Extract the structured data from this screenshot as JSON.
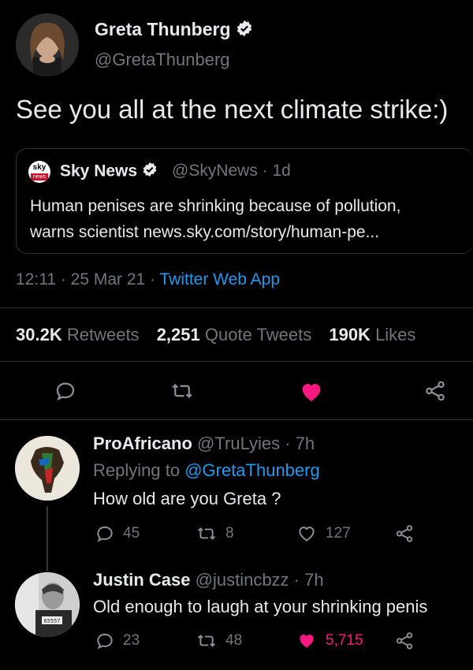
{
  "main_tweet": {
    "author_name": "Greta Thunberg",
    "author_handle": "@GretaThunberg",
    "text": "See you all at the next climate strike:)",
    "quoted": {
      "logo_text_top": "sky",
      "logo_text_bottom": "news",
      "name": "Sky News",
      "handle_time": "@SkyNews · 1d",
      "text_line1": "Human penises are shrinking because of pollution,",
      "text_line2": "warns scientist news.sky.com/story/human-pe..."
    },
    "time_date": "12:11 · 25 Mar 21 · ",
    "source": "Twitter Web App",
    "stats": {
      "retweets_count": "30.2K",
      "retweets_label": "Retweets",
      "quotes_count": "2,251",
      "quotes_label": "Quote Tweets",
      "likes_count": "190K",
      "likes_label": "Likes"
    },
    "colors": {
      "like": "#f91880",
      "link": "#1d9bf0"
    }
  },
  "replies": [
    {
      "name": "ProAfricano",
      "handle_time": "@TruLyies · 7h",
      "replying_prefix": "Replying to ",
      "replying_to": "@GretaThunberg",
      "text": "How old are you Greta ?",
      "reply_count": "45",
      "retweet_count": "8",
      "like_count": "127",
      "liked": false
    },
    {
      "name": "Justin Case",
      "handle_time": "@justincbzz · 7h",
      "text": "Old enough to laugh at your shrinking penis",
      "reply_count": "23",
      "retweet_count": "48",
      "like_count": "5,715",
      "liked": true
    }
  ]
}
